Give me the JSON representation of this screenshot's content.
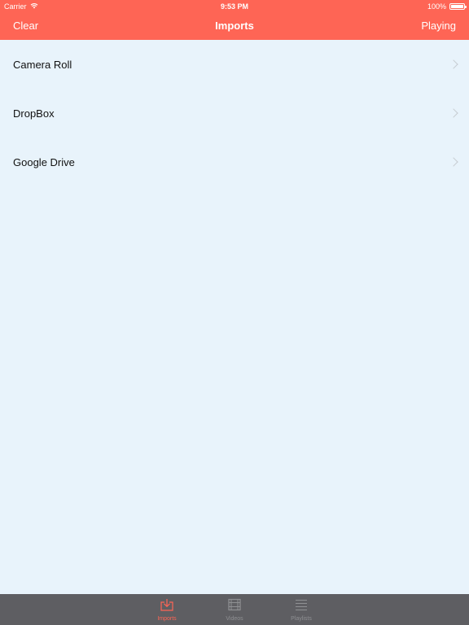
{
  "status_bar": {
    "carrier": "Carrier",
    "time": "9:53 PM",
    "battery_percent": "100%"
  },
  "nav": {
    "left_button": "Clear",
    "title": "Imports",
    "right_button": "Playing"
  },
  "list": {
    "items": [
      {
        "label": "Camera Roll"
      },
      {
        "label": "DropBox"
      },
      {
        "label": "Google Drive"
      }
    ]
  },
  "tab_bar": {
    "tabs": [
      {
        "label": "Imports",
        "icon": "download-icon",
        "active": true
      },
      {
        "label": "Videos",
        "icon": "film-icon",
        "active": false
      },
      {
        "label": "Playlists",
        "icon": "list-icon",
        "active": false
      }
    ]
  },
  "colors": {
    "accent": "#fe6555",
    "background": "#e8f3fb",
    "tab_bar": "#5e5e62",
    "tab_inactive": "#8f9093"
  }
}
